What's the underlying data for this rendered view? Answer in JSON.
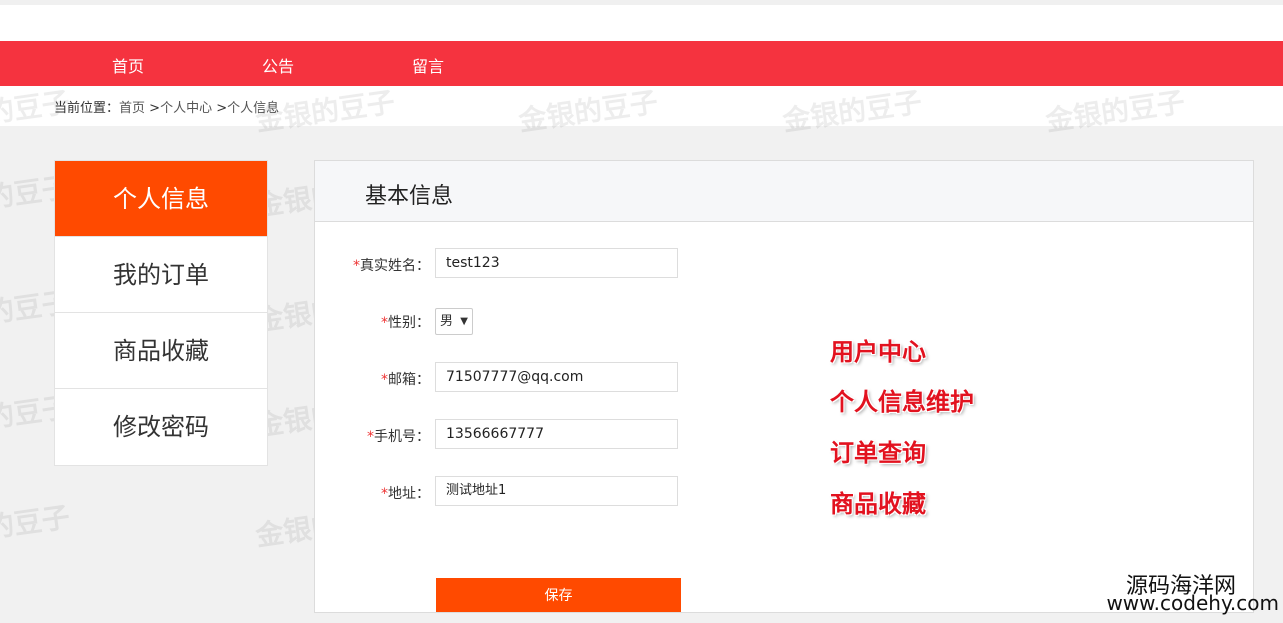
{
  "nav": {
    "items": [
      {
        "label": "首页"
      },
      {
        "label": "公告"
      },
      {
        "label": "留言"
      }
    ]
  },
  "breadcrumb": {
    "prefix": "当前位置：",
    "home": "首页",
    "sep1": " >",
    "user_center": "个人中心",
    "sep2": " >",
    "current": "个人信息"
  },
  "sidebar": {
    "items": [
      {
        "label": "个人信息",
        "active": true
      },
      {
        "label": "我的订单"
      },
      {
        "label": "商品收藏"
      },
      {
        "label": "修改密码"
      }
    ]
  },
  "panel": {
    "title": "基本信息"
  },
  "form": {
    "name": {
      "required": "*",
      "label": "真实姓名：",
      "value": "test123"
    },
    "gender": {
      "required": "*",
      "label": "性别：",
      "value": "男"
    },
    "email": {
      "required": "*",
      "label": "邮箱：",
      "value": "71507777@qq.com"
    },
    "phone": {
      "required": "*",
      "label": "手机号：",
      "value": "13566667777"
    },
    "address": {
      "required": "*",
      "label": "地址：",
      "value": "测试地址1"
    },
    "save_label": "保存"
  },
  "features": [
    "用户中心",
    "个人信息维护",
    "订单查询",
    "商品收藏"
  ],
  "watermark": "金银的豆子",
  "brand": {
    "line1": "源码海洋网",
    "line2": "www.codehy.com"
  },
  "colors": {
    "nav": "#f5333f",
    "accent": "#ff4a00",
    "feature": "#e2121f"
  }
}
